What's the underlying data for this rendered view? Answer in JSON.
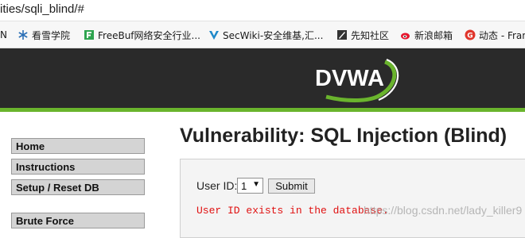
{
  "browser": {
    "url": "ities/sqli_blind/#",
    "bookmarks": [
      {
        "label": "N",
        "icon": "bookmark-icon"
      },
      {
        "label": "看雪学院",
        "icon": "snowflake-icon"
      },
      {
        "label": "FreeBuf网络安全行业...",
        "icon": "freebuf-icon"
      },
      {
        "label": "SecWiki-安全维基,汇...",
        "icon": "secwiki-icon"
      },
      {
        "label": "先知社区",
        "icon": "xianzhi-icon"
      },
      {
        "label": "新浪邮箱",
        "icon": "weibo-icon"
      },
      {
        "label": "动态 - Fran",
        "icon": "g-icon"
      }
    ]
  },
  "header": {
    "logo_text": "DVWA",
    "colors": {
      "bg": "#2a2a2a",
      "accent": "#6ab42d"
    }
  },
  "nav": {
    "items": [
      {
        "label": "Home"
      },
      {
        "label": "Instructions"
      },
      {
        "label": "Setup / Reset DB"
      },
      {
        "label": "Brute Force"
      }
    ]
  },
  "main": {
    "title": "Vulnerability: SQL Injection (Blind)",
    "form": {
      "user_id_label": "User ID:",
      "selected_value": "1",
      "submit_label": "Submit"
    },
    "result": "User ID exists in the database.",
    "watermark": "https://blog.csdn.net/lady_killer9"
  }
}
